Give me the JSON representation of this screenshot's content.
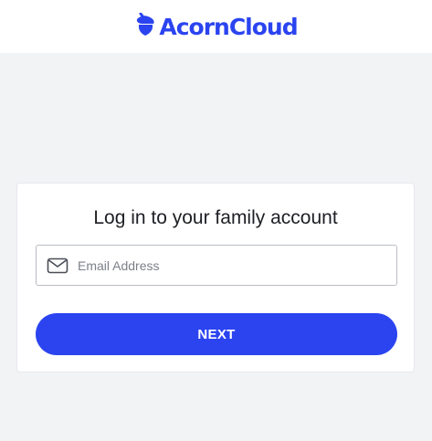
{
  "brand": {
    "name": "AcornCloud",
    "color": "#2b44f0",
    "logo_icon": "acorn-icon"
  },
  "login": {
    "title": "Log in to your family account",
    "email_placeholder": "Email Address",
    "email_value": "",
    "email_icon": "mail-icon",
    "next_label": "NEXT"
  }
}
